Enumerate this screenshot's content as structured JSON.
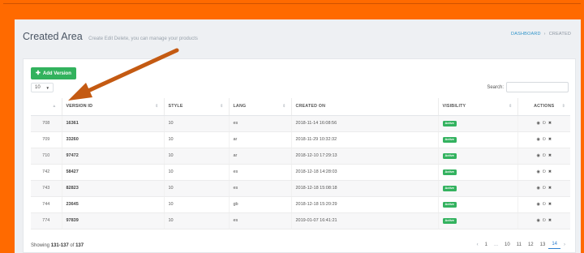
{
  "header": {
    "title": "Created Area",
    "subtitle": "Create Edit Delete, you can manage your products",
    "breadcrumb": [
      "DASHBOARD",
      "CREATED"
    ]
  },
  "toolbar": {
    "add_label": "Add Version",
    "page_length": "10",
    "search_label": "Search:",
    "search_value": ""
  },
  "table": {
    "headers": [
      "",
      "VERSION ID",
      "STYLE",
      "LANG",
      "CREATED ON",
      "VISIBILITY",
      "ACTIONS"
    ],
    "rows": [
      {
        "idx": "708",
        "version": "16361",
        "style": "10",
        "lang": "es",
        "created": "2018-11-14 16:08:56",
        "visibility": "Active"
      },
      {
        "idx": "709",
        "version": "33260",
        "style": "10",
        "lang": "ar",
        "created": "2018-11-29 10:32:32",
        "visibility": "Active"
      },
      {
        "idx": "710",
        "version": "97472",
        "style": "10",
        "lang": "ar",
        "created": "2018-12-10 17:29:13",
        "visibility": "Active"
      },
      {
        "idx": "742",
        "version": "58427",
        "style": "10",
        "lang": "es",
        "created": "2018-12-18 14:28:03",
        "visibility": "Active"
      },
      {
        "idx": "743",
        "version": "82823",
        "style": "10",
        "lang": "es",
        "created": "2018-12-18 15:08:18",
        "visibility": "Active"
      },
      {
        "idx": "744",
        "version": "23645",
        "style": "10",
        "lang": "gb",
        "created": "2018-12-18 15:20:29",
        "visibility": "Active"
      },
      {
        "idx": "774",
        "version": "97839",
        "style": "10",
        "lang": "es",
        "created": "2019-01-07 16:41:21",
        "visibility": "Active"
      }
    ]
  },
  "footer": {
    "showing_prefix": "Showing",
    "range": "131-137",
    "of_word": "of",
    "total": "137"
  },
  "pagination": {
    "prev": "‹",
    "pages": [
      "1",
      "...",
      "10",
      "11",
      "12",
      "13",
      "14"
    ],
    "active": "14",
    "next": "›"
  },
  "icons": {
    "add": "plus-icon",
    "view": "eye-icon",
    "toggle": "power-icon",
    "delete": "close-icon",
    "sort": "sort-icon",
    "annotation": "arrow-annotation"
  },
  "colors": {
    "frame": "#ff6a00",
    "add_button": "#32b25d",
    "badge": "#33b25f",
    "link": "#2f93c9",
    "arrow": "#c45a12"
  }
}
